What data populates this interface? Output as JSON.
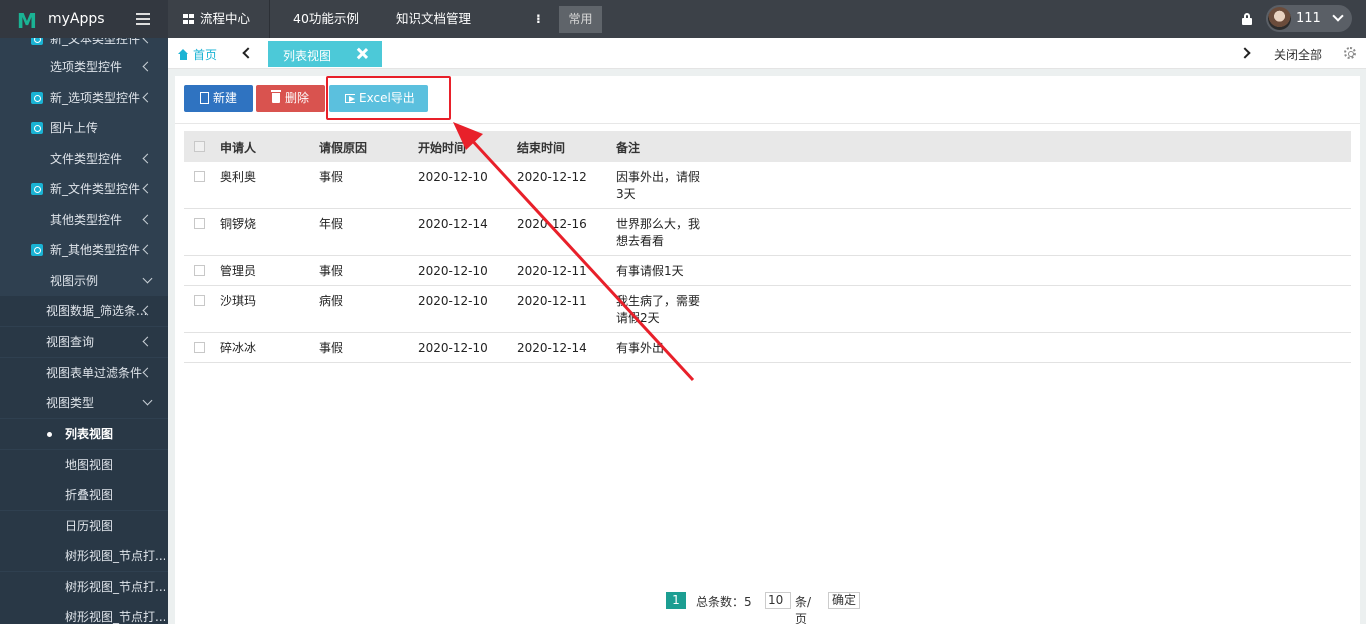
{
  "app": {
    "name": "myApps",
    "logo_mark": "M"
  },
  "topnav": {
    "items": [
      "流程中心",
      "40功能示例",
      "知识文档管理"
    ],
    "more_icon": "ellipsis-vertical-icon",
    "common_label": "常用",
    "user_name": "111"
  },
  "sidebar": {
    "items": [
      {
        "label": "新_文本类型控件",
        "icon": true
      },
      {
        "label": "选项类型控件",
        "icon": false
      },
      {
        "label": "新_选项类型控件",
        "icon": true
      },
      {
        "label": "图片上传",
        "icon": true
      },
      {
        "label": "文件类型控件",
        "icon": false
      },
      {
        "label": "新_文件类型控件",
        "icon": true
      },
      {
        "label": "其他类型控件",
        "icon": false
      },
      {
        "label": "新_其他类型控件",
        "icon": true
      },
      {
        "label": "视图示例",
        "icon": false
      },
      {
        "label": "视图数据_筛选条...",
        "icon": false
      },
      {
        "label": "视图查询",
        "icon": false
      },
      {
        "label": "视图表单过滤条件",
        "icon": false
      },
      {
        "label": "视图类型",
        "icon": false
      },
      {
        "label": "列表视图",
        "icon": false
      },
      {
        "label": "地图视图",
        "icon": false
      },
      {
        "label": "折叠视图",
        "icon": false
      },
      {
        "label": "日历视图",
        "icon": false
      },
      {
        "label": "树形视图_节点打...",
        "icon": false
      },
      {
        "label": "树形视图_节点打...",
        "icon": false
      },
      {
        "label": "树形视图_节点打...",
        "icon": false
      }
    ]
  },
  "tabs": {
    "home_label": "首页",
    "active_label": "列表视图",
    "close_all_label": "关闭全部"
  },
  "toolbar": {
    "new_label": "新建",
    "delete_label": "删除",
    "export_label": "Excel导出"
  },
  "table": {
    "columns": [
      "申请人",
      "请假原因",
      "开始时间",
      "结束时间",
      "备注"
    ],
    "rows": [
      {
        "applicant": "奥利奥",
        "reason": "事假",
        "start": "2020-12-10",
        "end": "2020-12-12",
        "note_l1": "因事外出，请假",
        "note_l2": "3天"
      },
      {
        "applicant": "铜锣烧",
        "reason": "年假",
        "start": "2020-12-14",
        "end": "2020-12-16",
        "note_l1": "世界那么大，我",
        "note_l2": "想去看看"
      },
      {
        "applicant": "管理员",
        "reason": "事假",
        "start": "2020-12-10",
        "end": "2020-12-11",
        "note_l1": "有事请假1天",
        "note_l2": ""
      },
      {
        "applicant": "沙琪玛",
        "reason": "病假",
        "start": "2020-12-10",
        "end": "2020-12-11",
        "note_l1": "我生病了，需要",
        "note_l2": "请假2天"
      },
      {
        "applicant": "碎冰冰",
        "reason": "事假",
        "start": "2020-12-10",
        "end": "2020-12-14",
        "note_l1": "有事外出",
        "note_l2": ""
      }
    ]
  },
  "pager": {
    "current_page": "1",
    "total_label": "总条数：5",
    "page_size": "10",
    "per_page_label": "条/页",
    "confirm_label": "确定"
  },
  "colors": {
    "sidebar_bg": "#2f4050",
    "topbar_bg": "#3c4148",
    "accent_teal": "#4cc9d8",
    "new_button": "#2f73c1",
    "delete_button": "#d9534f",
    "export_button": "#5bc0de",
    "annotation_red": "#e8202a"
  }
}
